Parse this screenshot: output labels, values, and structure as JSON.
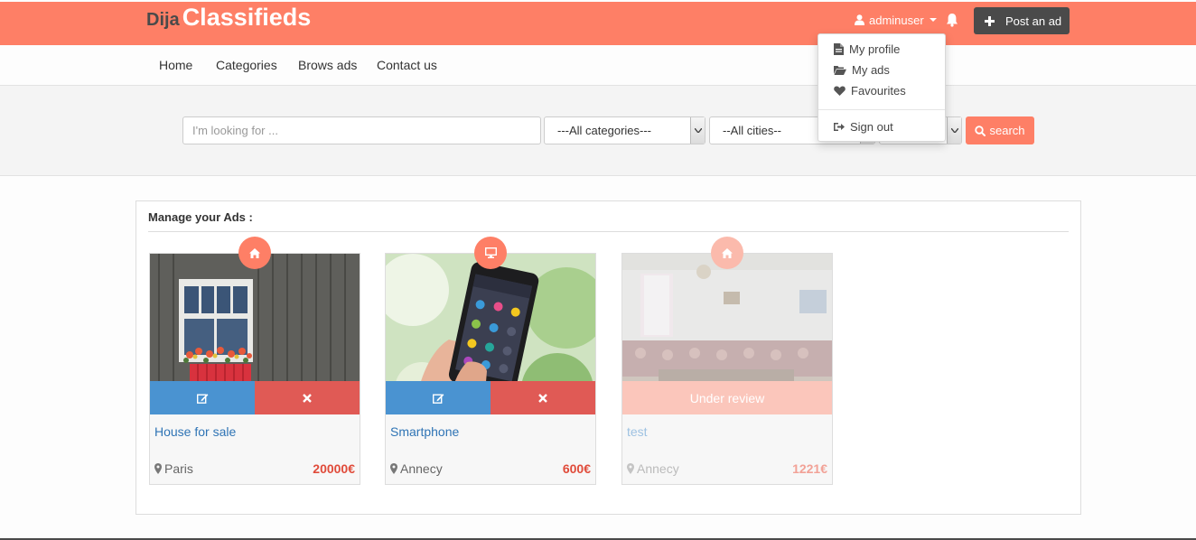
{
  "brand": {
    "part1": "Dija",
    "part2": "Classifieds"
  },
  "header": {
    "username": "adminuser",
    "post_label": "Post an ad"
  },
  "user_dropdown": {
    "items": [
      {
        "label": "My profile",
        "icon": "file-icon"
      },
      {
        "label": "My ads",
        "icon": "folder-open-icon"
      },
      {
        "label": "Favourites",
        "icon": "heart-icon"
      },
      {
        "label": "Sign out",
        "icon": "sign-out-icon"
      }
    ]
  },
  "nav": {
    "items": [
      {
        "label": "Home"
      },
      {
        "label": "Categories"
      },
      {
        "label": "Brows ads"
      },
      {
        "label": "Contact us"
      }
    ]
  },
  "search": {
    "placeholder": "I'm looking for ...",
    "category": "---All categories---",
    "city": "--All cities--",
    "button_label": "search"
  },
  "manage": {
    "title": "Manage your Ads :",
    "ads": [
      {
        "title": "House for sale",
        "city": "Paris",
        "price": "20000€",
        "category_icon": "home-icon",
        "status": "active"
      },
      {
        "title": "Smartphone",
        "city": "Annecy",
        "price": "600€",
        "category_icon": "desktop-icon",
        "status": "active"
      },
      {
        "title": "test",
        "city": "Annecy",
        "price": "1221€",
        "category_icon": "home-icon",
        "status": "Under review"
      }
    ]
  },
  "colors": {
    "brand": "#fe7f66",
    "dark": "#4a4a4a",
    "edit": "#4a93d1",
    "delete": "#e05a55",
    "price": "#e04b3a"
  }
}
